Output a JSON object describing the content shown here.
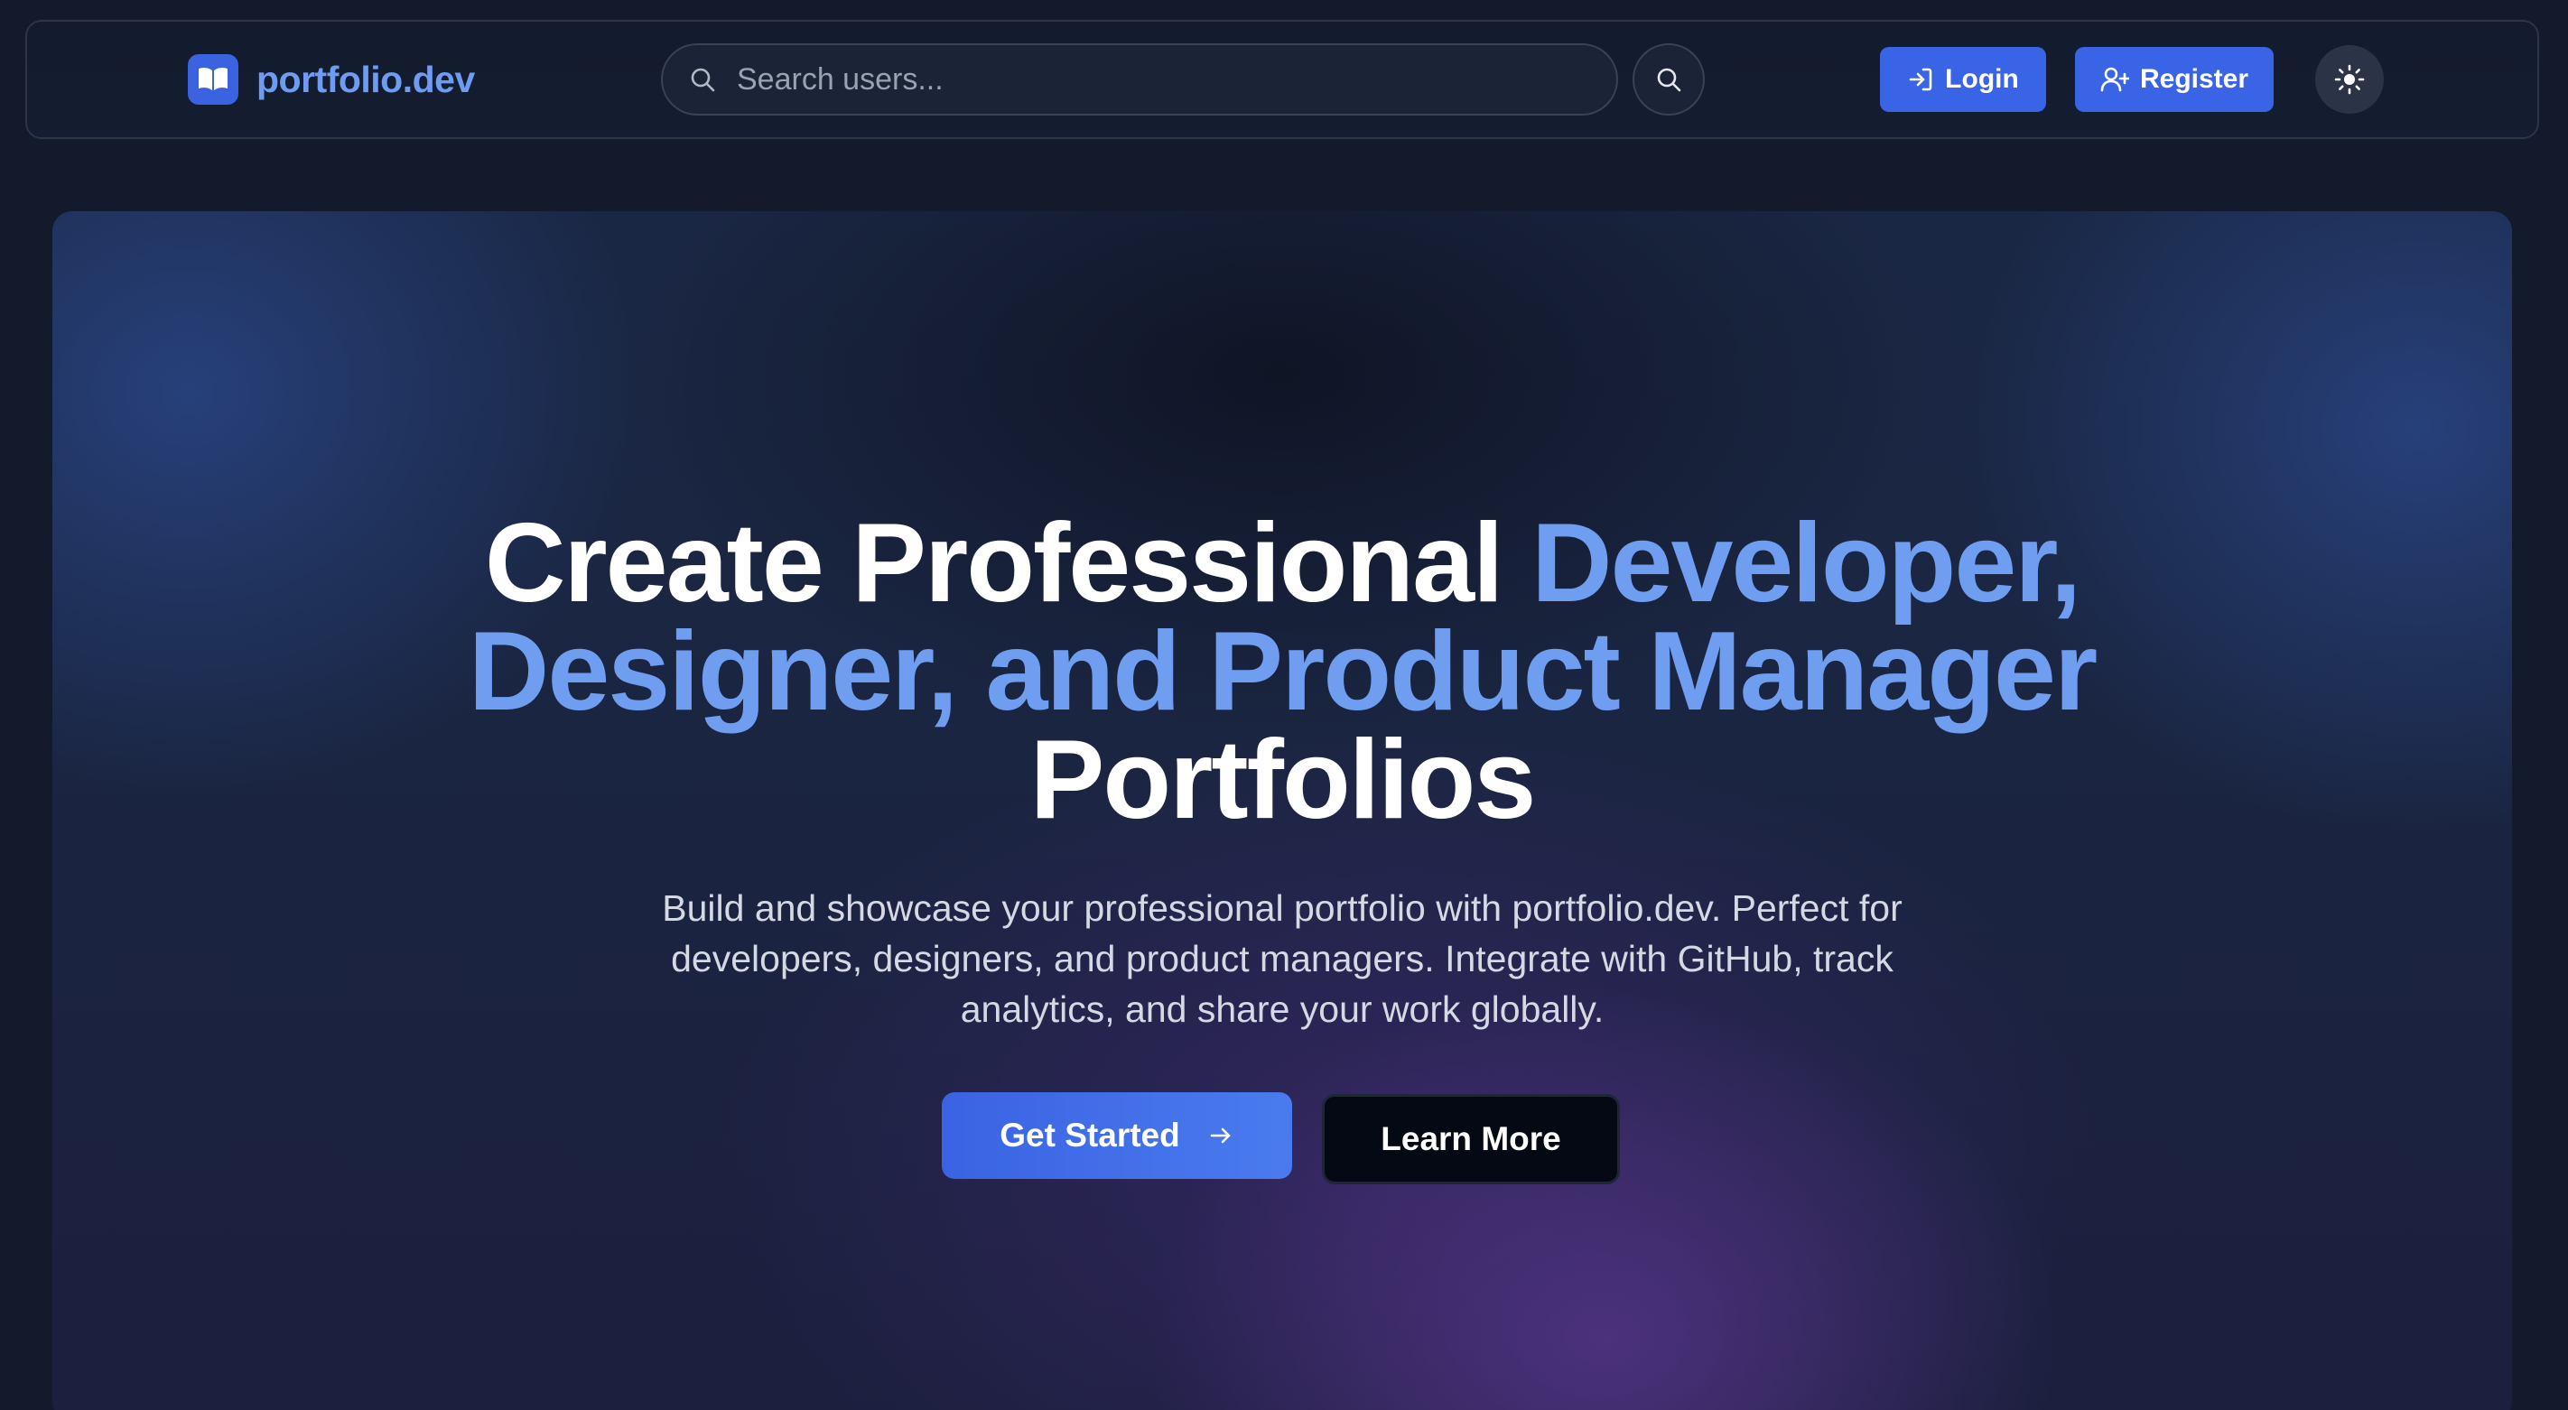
{
  "navbar": {
    "brand": "portfolio.dev",
    "search_placeholder": "Search users...",
    "login_label": "Login",
    "register_label": "Register"
  },
  "hero": {
    "headline": {
      "line1_white": "Create Professional ",
      "line1_blue": "Developer,",
      "line2_blue": "Designer, and Product Manager",
      "line3_white": "Portfolios"
    },
    "subtitle_lines": [
      "Build and showcase your professional portfolio with portfolio.dev. Perfect for",
      "developers, designers, and product managers. Integrate with GitHub, track",
      "analytics, and share your work globally."
    ],
    "primary_cta": "Get Started",
    "secondary_cta": "Learn More"
  },
  "icons": {
    "brand": "open-book-icon",
    "search": "search-icon",
    "search_button": "search-icon",
    "login": "log-in-icon",
    "register": "user-plus-icon",
    "theme": "sun-icon",
    "cta": "arrow-right-icon"
  },
  "colors": {
    "accent": "#3a64e6",
    "headline_blue": "#6f9ef0",
    "background": "#121a2c"
  }
}
